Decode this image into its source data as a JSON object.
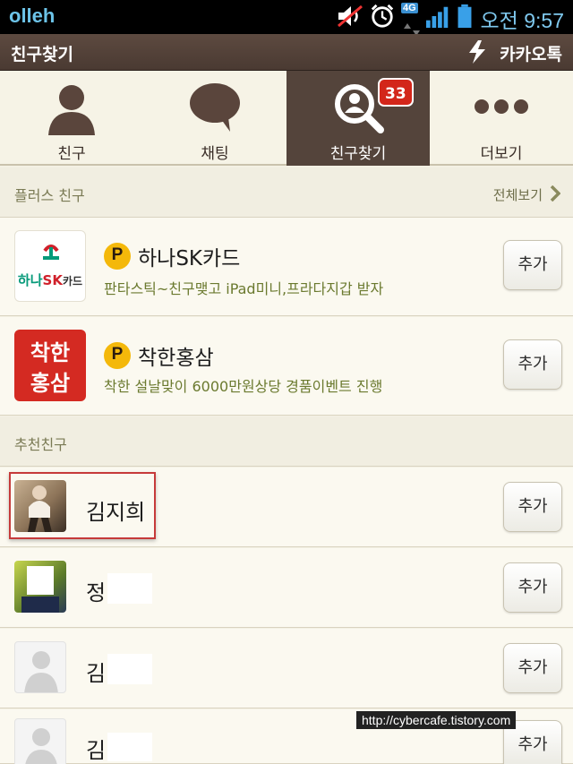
{
  "status_bar": {
    "carrier": "olleh",
    "network": "4G",
    "time": "오전 9:57"
  },
  "title_bar": {
    "title": "친구찾기",
    "brand": "카카오톡"
  },
  "tabs": [
    {
      "label": "친구",
      "icon": "person-icon"
    },
    {
      "label": "채팅",
      "icon": "chat-bubble-icon"
    },
    {
      "label": "친구찾기",
      "icon": "search-person-icon",
      "badge": "33",
      "active": true
    },
    {
      "label": "더보기",
      "icon": "more-dots-icon"
    }
  ],
  "plus_section": {
    "title": "플러스 친구",
    "see_all": "전체보기"
  },
  "plus_friends": [
    {
      "name": "하나SK카드",
      "desc": "판타스틱~친구맺고 iPad미니,프라다지갑 받자",
      "add": "추가",
      "logo_text_1": "하나",
      "logo_text_2": "SK",
      "logo_text_3": "카드"
    },
    {
      "name": "착한홍삼",
      "desc": "착한 설날맞이 6000만원상당 경품이벤트 진행",
      "add": "추가",
      "logo_text_1": "착한",
      "logo_text_2": "홍삼"
    }
  ],
  "recommend_section": {
    "title": "추천친구"
  },
  "recommended": [
    {
      "name": "김지희",
      "add": "추가"
    },
    {
      "name": "정",
      "add": "추가"
    },
    {
      "name": "김",
      "add": "추가"
    },
    {
      "name": "김",
      "add": "추가"
    }
  ],
  "p_badge": "P",
  "watermark": "http://cybercafe.tistory.com",
  "colors": {
    "accent": "#54443b",
    "badge": "#d3261a",
    "plus": "#f4b80a"
  }
}
